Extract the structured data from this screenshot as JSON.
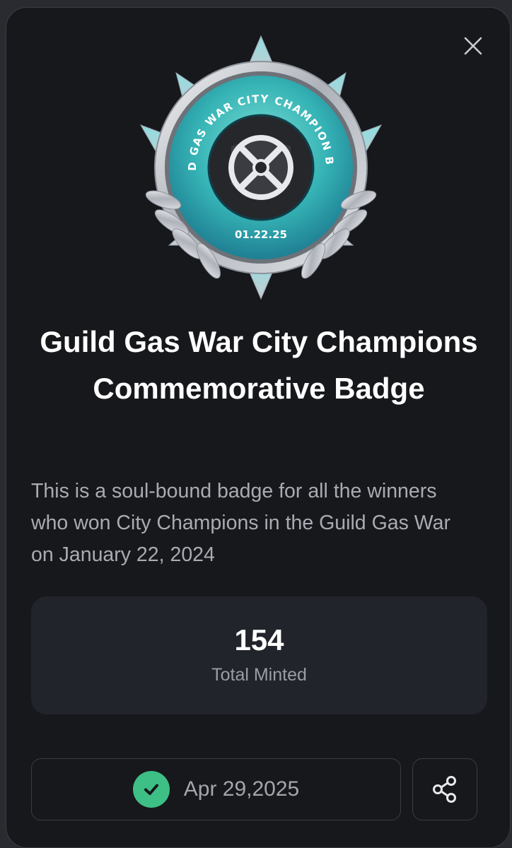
{
  "modal": {
    "close_icon": "close-icon"
  },
  "badge": {
    "ring_text": "GUILD GAS WAR CITY CHAMPION BADGE",
    "date_text": "01.22.25",
    "colors": {
      "ring": "#3fb8b5",
      "silver": "#c9ccd2",
      "center": "#26272b"
    }
  },
  "title": "Guild Gas War City Champions Commemorative Badge",
  "description": "This is a soul-bound badge for all the winners who won City Champions in the Guild Gas War on January 22, 2024",
  "stats": {
    "value": "154",
    "label": "Total Minted"
  },
  "footer": {
    "date": "Apr 29,2025",
    "check_icon": "check-circle-icon",
    "share_icon": "share-icon",
    "accent": "#3dbf86"
  }
}
